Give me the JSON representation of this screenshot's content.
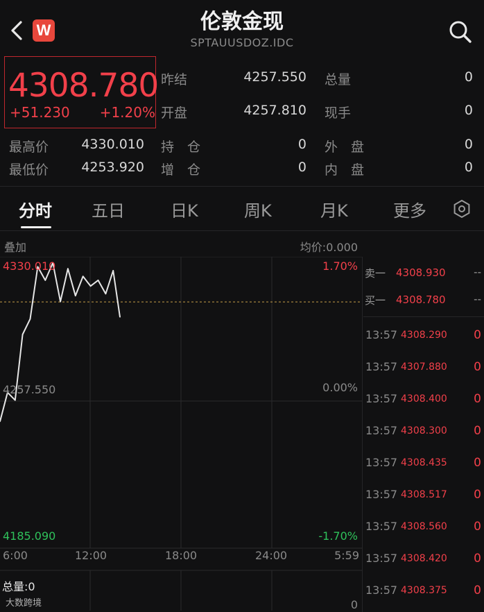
{
  "header": {
    "title": "伦敦金现",
    "subtitle": "SPTAUUSDOZ.IDC",
    "logo": "W"
  },
  "quote": {
    "price": "4308.780",
    "change": "+51.230",
    "change_pct": "+1.20%"
  },
  "stats": [
    {
      "label": "昨结",
      "value": "4257.550"
    },
    {
      "label": "总量",
      "value": "0"
    },
    {
      "label": "开盘",
      "value": "4257.810"
    },
    {
      "label": "现手",
      "value": "0"
    },
    {
      "label": "最高价",
      "value": "4330.010"
    },
    {
      "label": "持　仓",
      "value": "0"
    },
    {
      "label": "外　盘",
      "value": "0"
    },
    {
      "label": "最低价",
      "value": "4253.920"
    },
    {
      "label": "增　仓",
      "value": "0"
    },
    {
      "label": "内　盘",
      "value": "0"
    }
  ],
  "tabs": [
    {
      "label": "分时"
    },
    {
      "label": "五日"
    },
    {
      "label": "日K"
    },
    {
      "label": "周K"
    },
    {
      "label": "月K"
    },
    {
      "label": "更多"
    }
  ],
  "chart": {
    "overlay_label": "叠加",
    "avg_price_label": "均价:0.000",
    "y_high": "4330.010",
    "y_mid": "4257.550",
    "y_low": "4185.090",
    "pct_high": "1.70%",
    "pct_mid": "0.00%",
    "pct_low": "-1.70%",
    "x_labels": [
      "6:00",
      "12:00",
      "18:00",
      "24:00",
      "5:59"
    ],
    "volume_label": "总量:0",
    "volume_zero": "0",
    "watermark": "大数跨境",
    "colors": {
      "line": "#e6e6e6",
      "red": "#f2404a",
      "green": "#2fc25b",
      "grid": "#2a2a2c",
      "dash": "#c8a04a"
    }
  },
  "chart_data": {
    "type": "line",
    "x": [
      "6:00",
      "6:30",
      "7:00",
      "7:30",
      "8:00",
      "8:30",
      "9:00",
      "9:30",
      "10:00",
      "10:30",
      "11:00",
      "11:30",
      "12:00",
      "12:30",
      "13:00",
      "13:30",
      "13:57"
    ],
    "values": [
      4247,
      4262,
      4258,
      4292,
      4300,
      4327,
      4320,
      4329,
      4309,
      4326,
      4312,
      4322,
      4317,
      4320,
      4313,
      4325,
      4301
    ],
    "ylim": [
      4185.09,
      4330.01
    ],
    "baseline": 4257.55,
    "current": 4308.78,
    "x_labels": [
      "6:00",
      "12:00",
      "18:00",
      "24:00",
      "5:59"
    ],
    "grid": true
  },
  "order_book": [
    {
      "label": "卖一",
      "price": "4308.930",
      "vol": "--"
    },
    {
      "label": "买一",
      "price": "4308.780",
      "vol": "--"
    }
  ],
  "trades": [
    {
      "time": "13:57",
      "price": "4308.290",
      "vol": "0"
    },
    {
      "time": "13:57",
      "price": "4307.880",
      "vol": "0"
    },
    {
      "time": "13:57",
      "price": "4308.400",
      "vol": "0"
    },
    {
      "time": "13:57",
      "price": "4308.300",
      "vol": "0"
    },
    {
      "time": "13:57",
      "price": "4308.435",
      "vol": "0"
    },
    {
      "time": "13:57",
      "price": "4308.517",
      "vol": "0"
    },
    {
      "time": "13:57",
      "price": "4308.560",
      "vol": "0"
    },
    {
      "time": "13:57",
      "price": "4308.420",
      "vol": "0"
    },
    {
      "time": "13:57",
      "price": "4308.375",
      "vol": "0"
    }
  ]
}
